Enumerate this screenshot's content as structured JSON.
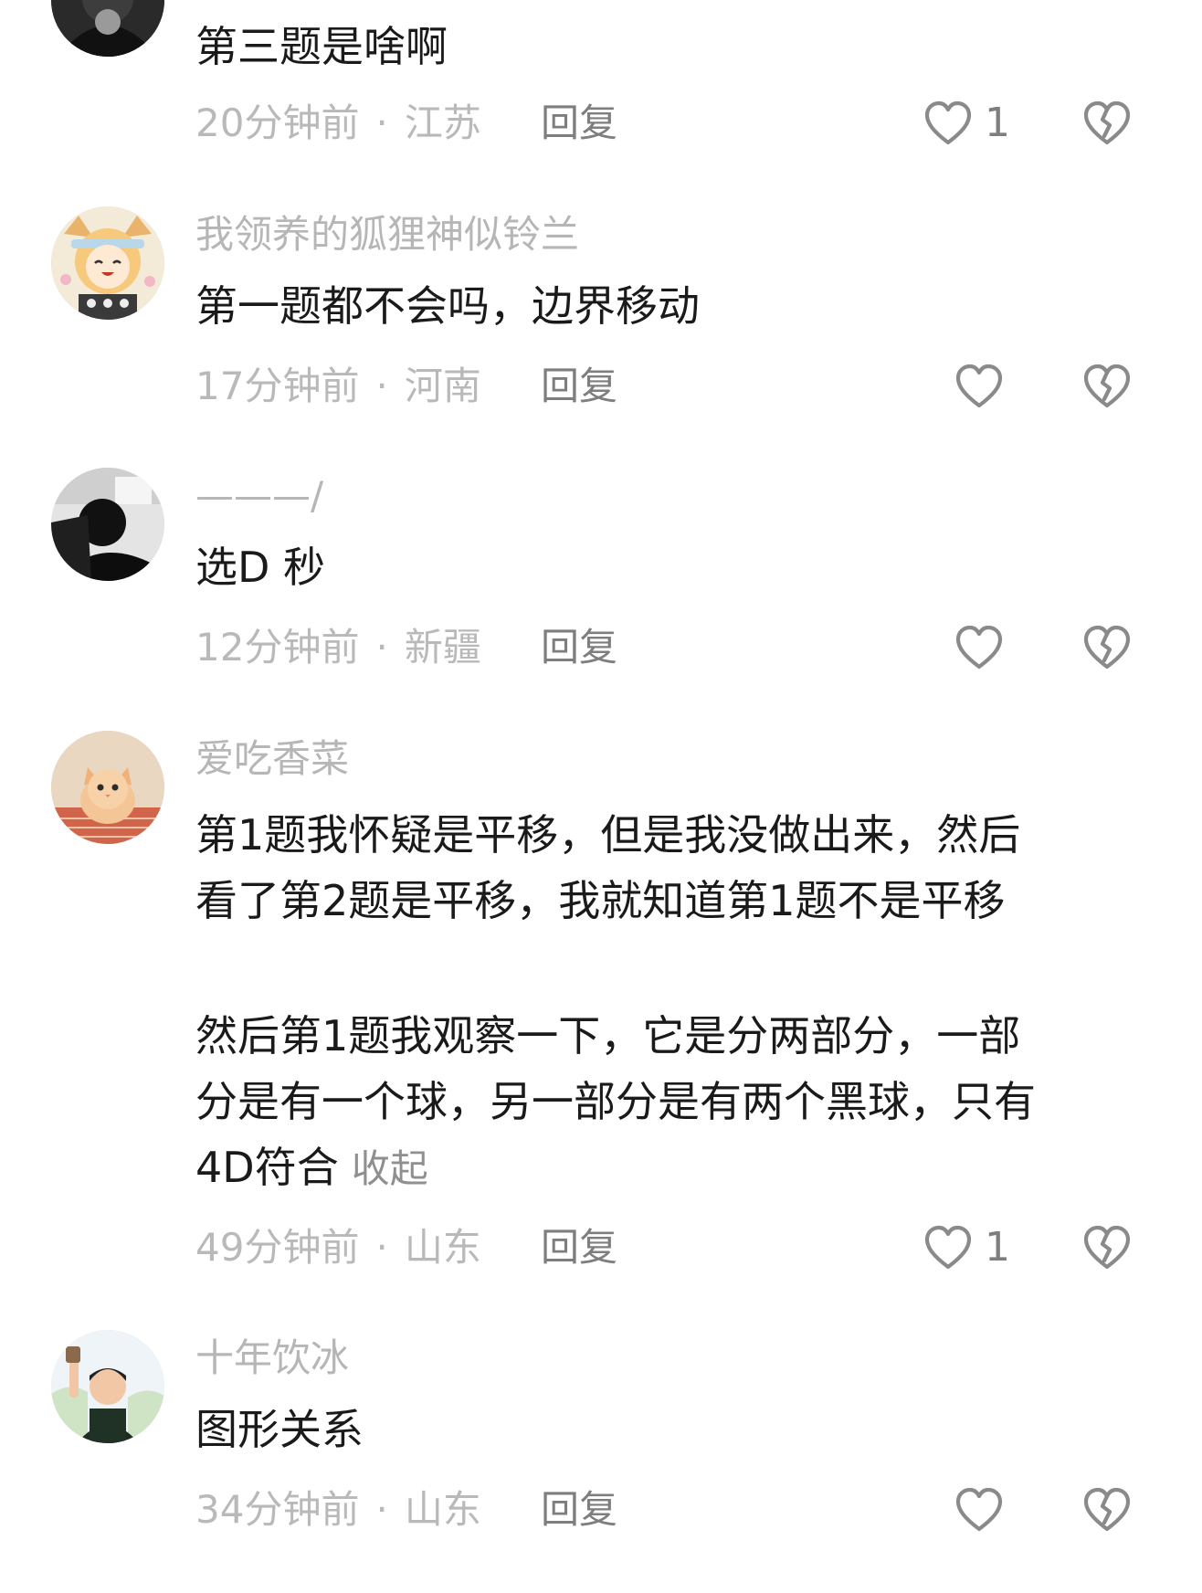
{
  "comments": [
    {
      "username": "",
      "lines": [
        "第三题是啥啊"
      ],
      "time": "20分钟前",
      "location": "江苏",
      "reply_label": "回复",
      "likes": "1"
    },
    {
      "username": "我领养的狐狸神似铃兰",
      "lines": [
        "第一题都不会吗，边界移动"
      ],
      "time": "17分钟前",
      "location": "河南",
      "reply_label": "回复",
      "likes": ""
    },
    {
      "username": "———/",
      "lines": [
        "选D 秒"
      ],
      "time": "12分钟前",
      "location": "新疆",
      "reply_label": "回复",
      "likes": ""
    },
    {
      "username": "爱吃香菜",
      "lines": [
        "第1题我怀疑是平移，但是我没做出来，然后",
        "看了第2题是平移，我就知道第1题不是平移",
        "然后第1题我观察一下，它是分两部分，一部",
        "分是有一个球，另一部分是有两个黑球，只有",
        "4D符合"
      ],
      "collapse_label": "收起",
      "time": "49分钟前",
      "location": "山东",
      "reply_label": "回复",
      "likes": "1"
    },
    {
      "username": "十年饮冰",
      "lines": [
        "图形关系"
      ],
      "time": "34分钟前",
      "location": "山东",
      "reply_label": "回复",
      "likes": ""
    }
  ],
  "separator": "·",
  "icons": {
    "like": "heart-outline-icon",
    "dislike": "broken-heart-icon"
  },
  "colors": {
    "text": "#1a1a1a",
    "username": "#b6b6b6",
    "meta": "#b9b9b9",
    "icon": "#8a8a8a"
  }
}
